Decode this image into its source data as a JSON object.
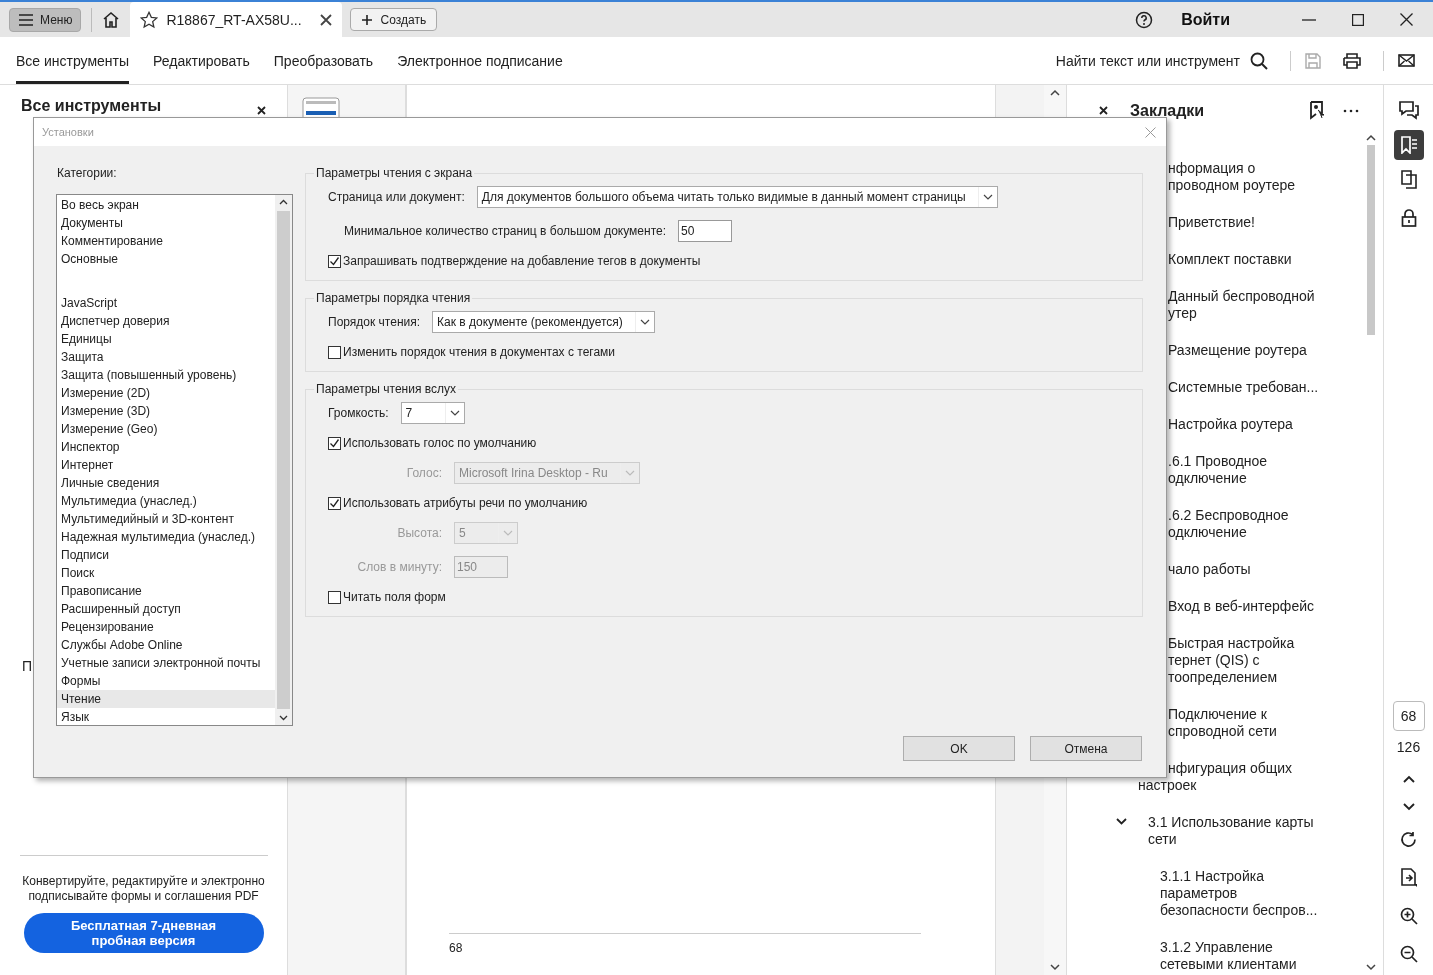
{
  "top_bar": {
    "menu_button": "Меню",
    "tab_title": "R18867_RT-AX58U...",
    "create_button": "Создать",
    "sign_in": "Войти"
  },
  "toolbar": {
    "tabs": [
      {
        "label": "Все инструменты",
        "selected": true
      },
      {
        "label": "Редактировать",
        "selected": false
      },
      {
        "label": "Преобразовать",
        "selected": false
      },
      {
        "label": "Электронное подписание",
        "selected": false
      }
    ],
    "search_label": "Найти текст или инструмент"
  },
  "tools_panel": {
    "title": "Все инструменты",
    "fragment": "П",
    "promo_text": "Конвертируйте, редактируйте и электронно подписывайте формы и соглашения PDF",
    "trial_button": "Бесплатная 7-дневная пробная версия"
  },
  "document": {
    "page_number": "68"
  },
  "bookmarks_panel": {
    "title": "Закладки",
    "items": [
      {
        "lines": [
          "нформация о",
          "проводном роутере"
        ]
      },
      {
        "lines": [
          "Приветствие!"
        ]
      },
      {
        "lines": [
          "Комплект поставки"
        ]
      },
      {
        "lines": [
          "Данный беспроводной",
          "утер"
        ]
      },
      {
        "lines": [
          "Размещение роутера"
        ]
      },
      {
        "lines": [
          "Системные требован..."
        ]
      },
      {
        "lines": [
          "Настройка роутера"
        ]
      },
      {
        "lines": [
          ".6.1 Проводное",
          "одключение"
        ]
      },
      {
        "lines": [
          ".6.2 Беспроводное",
          "одключение"
        ]
      },
      {
        "lines": [
          "чало работы"
        ]
      },
      {
        "lines": [
          "Вход в веб-интерфейс"
        ]
      },
      {
        "lines": [
          "Быстрая настройка",
          "тернет (QIS) с",
          "тоопределением"
        ]
      },
      {
        "lines": [
          "Подключение к",
          "спроводной сети"
        ]
      },
      {
        "lines": [
          "нфигурация общих",
          "настроек"
        ],
        "children": [
          {
            "lines": [
              "3.1 Использование карты",
              "сети"
            ],
            "expanded": true,
            "children": [
              {
                "lines": [
                  "3.1.1 Настройка",
                  "параметров",
                  "безопасности беспров..."
                ]
              },
              {
                "lines": [
                  "3.1.2 Управление",
                  "сетевыми клиентами"
                ]
              }
            ]
          }
        ]
      }
    ]
  },
  "page_nav": {
    "current_page": "68",
    "total_pages": "126"
  },
  "dialog": {
    "title": "Установки",
    "categories_label": "Категории:",
    "pinned_categories": [
      {
        "label": "Во весь экран",
        "selected": false
      },
      {
        "label": "Документы",
        "selected": false
      },
      {
        "label": "Комментирование",
        "selected": false
      },
      {
        "label": "Основные",
        "selected": false
      }
    ],
    "categories": [
      {
        "label": "JavaScript",
        "selected": false
      },
      {
        "label": "Диспетчер доверия",
        "selected": false
      },
      {
        "label": "Единицы",
        "selected": false
      },
      {
        "label": "Защита",
        "selected": false
      },
      {
        "label": "Защита (повышенный уровень)",
        "selected": false
      },
      {
        "label": "Измерение (2D)",
        "selected": false
      },
      {
        "label": "Измерение (3D)",
        "selected": false
      },
      {
        "label": "Измерение (Geo)",
        "selected": false
      },
      {
        "label": "Инспектор",
        "selected": false
      },
      {
        "label": "Интернет",
        "selected": false
      },
      {
        "label": "Личные сведения",
        "selected": false
      },
      {
        "label": "Мультимедиа (унаслед.)",
        "selected": false
      },
      {
        "label": "Мультимедийный и 3D-контент",
        "selected": false
      },
      {
        "label": "Надежная мультимедиа (унаслед.)",
        "selected": false
      },
      {
        "label": "Подписи",
        "selected": false
      },
      {
        "label": "Поиск",
        "selected": false
      },
      {
        "label": "Правописание",
        "selected": false
      },
      {
        "label": "Расширенный доступ",
        "selected": false
      },
      {
        "label": "Рецензирование",
        "selected": false
      },
      {
        "label": "Службы Adobe Online",
        "selected": false
      },
      {
        "label": "Учетные записи электронной почты",
        "selected": false
      },
      {
        "label": "Формы",
        "selected": false
      },
      {
        "label": "Чтение",
        "selected": true
      },
      {
        "label": "Язык",
        "selected": false
      }
    ],
    "sections": [
      {
        "title": "Параметры чтения с экрана",
        "rows": [
          {
            "kind": "select",
            "label": "Страница или документ:",
            "value": "Для документов большого объема читать только видимые в данный момент страницы",
            "disabled": false
          },
          {
            "kind": "number",
            "label": "Минимальное количество страниц в большом документе:",
            "value": "50",
            "disabled": false
          },
          {
            "kind": "checkbox",
            "label": "Запрашивать подтверждение на добавление тегов в документы",
            "checked": true
          }
        ]
      },
      {
        "title": "Параметры порядка чтения",
        "rows": [
          {
            "kind": "select",
            "label": "Порядок чтения:",
            "value": "Как в документе (рекомендуется)",
            "disabled": false
          },
          {
            "kind": "checkbox",
            "label": "Изменить порядок чтения в документах с тегами",
            "checked": false
          }
        ]
      },
      {
        "title": "Параметры чтения вслух",
        "rows": [
          {
            "kind": "select",
            "label": "Громкость:",
            "value": "7",
            "disabled": false
          },
          {
            "kind": "checkbox",
            "label": "Использовать голос по умолчанию",
            "checked": true
          },
          {
            "kind": "select",
            "label": "Голос:",
            "value": "Microsoft Irina Desktop - Ru",
            "disabled": true
          },
          {
            "kind": "checkbox",
            "label": "Использовать атрибуты речи по умолчанию",
            "checked": true
          },
          {
            "kind": "select",
            "label": "Высота:",
            "value": "5",
            "disabled": true
          },
          {
            "kind": "number",
            "label": "Слов в минуту:",
            "value": "150",
            "disabled": true
          },
          {
            "kind": "checkbox",
            "label": "Читать поля форм",
            "checked": false
          }
        ]
      }
    ],
    "buttons": [
      "OK",
      "Отмена"
    ]
  }
}
